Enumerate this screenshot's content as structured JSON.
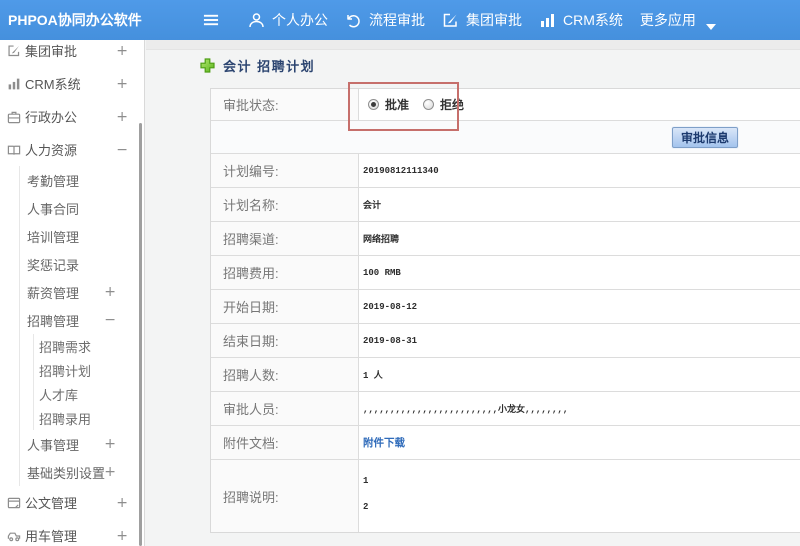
{
  "topbar": {
    "brand": "PHPOA协同办公软件",
    "nav": [
      {
        "label": "个人办公",
        "icon": "user-icon"
      },
      {
        "label": "流程审批",
        "icon": "process-icon"
      },
      {
        "label": "集团审批",
        "icon": "edit-icon"
      },
      {
        "label": "CRM系统",
        "icon": "chart-icon"
      },
      {
        "label": "更多应用",
        "icon": null,
        "caret": true
      }
    ]
  },
  "sidebar": {
    "items": [
      {
        "label": "集团审批",
        "icon": "edit-icon",
        "expander": "+"
      },
      {
        "label": "CRM系统",
        "icon": "chart-icon",
        "expander": "+"
      },
      {
        "label": "行政办公",
        "icon": "briefcase-icon",
        "expander": "+"
      },
      {
        "label": "人力资源",
        "icon": "book-icon",
        "expander": "−",
        "children": [
          {
            "label": "考勤管理"
          },
          {
            "label": "人事合同"
          },
          {
            "label": "培训管理"
          },
          {
            "label": "奖惩记录"
          },
          {
            "label": "薪资管理",
            "expander": "+"
          },
          {
            "label": "招聘管理",
            "expander": "−",
            "children": [
              {
                "label": "招聘需求"
              },
              {
                "label": "招聘计划"
              },
              {
                "label": "人才库"
              },
              {
                "label": "招聘录用"
              }
            ]
          },
          {
            "label": "人事管理",
            "expander": "+"
          },
          {
            "label": "基础类别设置",
            "expander": "+"
          }
        ]
      },
      {
        "label": "公文管理",
        "icon": "document-icon",
        "expander": "+"
      },
      {
        "label": "用车管理",
        "icon": "car-icon",
        "expander": "+"
      }
    ]
  },
  "main": {
    "title": "会计 招聘计划",
    "form": {
      "rows": [
        {
          "type": "radios",
          "label": "审批状态:",
          "options": [
            {
              "label": "批准",
              "selected": true
            },
            {
              "label": "拒绝",
              "selected": false
            }
          ]
        },
        {
          "type": "button",
          "button_label": "审批信息"
        },
        {
          "type": "text",
          "label": "计划编号:",
          "value": "20190812111340"
        },
        {
          "type": "text",
          "label": "计划名称:",
          "value": "会计"
        },
        {
          "type": "text",
          "label": "招聘渠道:",
          "value": "网络招聘"
        },
        {
          "type": "text",
          "label": "招聘费用:",
          "value": "100 RMB"
        },
        {
          "type": "text",
          "label": "开始日期:",
          "value": "2019-08-12"
        },
        {
          "type": "text",
          "label": "结束日期:",
          "value": "2019-08-31"
        },
        {
          "type": "text",
          "label": "招聘人数:",
          "value": "1 人"
        },
        {
          "type": "text",
          "label": "审批人员:",
          "value": ",,,,,,,,,,,,,,,,,,,,,,,,,小龙女,,,,,,,,"
        },
        {
          "type": "link",
          "label": "附件文档:",
          "value": "附件下载"
        },
        {
          "type": "multiline",
          "label": "招聘说明:",
          "lines": [
            "1",
            "2"
          ]
        }
      ]
    },
    "annotation_color": "#c66f6b"
  },
  "colors": {
    "topbar_blue": "#4a94e4",
    "title_navy": "#2b4470",
    "link_blue": "#2f6bba",
    "annotation_red": "#c66f6b",
    "plus_green": "#5bb41d",
    "button_face_blue": "#a3c3ed"
  }
}
